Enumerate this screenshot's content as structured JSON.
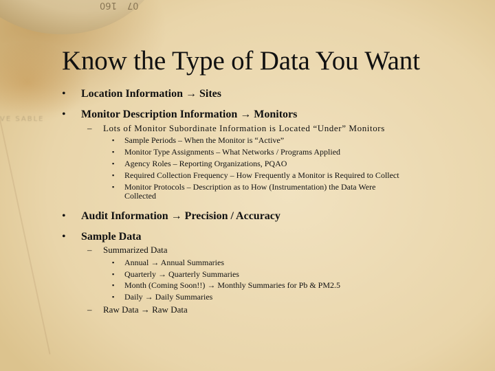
{
  "slide": {
    "title": "Know the Type of Data You Want",
    "background": {
      "compass_numbers": [
        "160",
        "07"
      ],
      "map_label": "VE SABLE"
    },
    "bullet_glyph": "•",
    "dash_glyph": "–",
    "items": [
      {
        "label": "Location Information → Sites"
      },
      {
        "label": "Monitor Description Information → Monitors",
        "sub": {
          "label": "Lots of Monitor Subordinate Information is Located “Under” Monitors",
          "items": [
            "Sample Periods – When the Monitor is “Active”",
            "Monitor Type Assignments – What Networks / Programs Applied",
            "Agency Roles – Reporting Organizations, PQAO",
            "Required Collection Frequency – How Frequently a Monitor is Required to Collect",
            "Monitor Protocols – Description as to How (Instrumentation) the Data Were",
            "Collected"
          ]
        }
      },
      {
        "label": "Audit Information → Precision / Accuracy"
      },
      {
        "label": "Sample Data",
        "subs": [
          {
            "label": "Summarized Data",
            "items": [
              "Annual → Annual Summaries",
              "Quarterly → Quarterly Summaries",
              "Month (Coming Soon!!) → Monthly Summaries for Pb & PM2.5",
              "Daily → Daily Summaries"
            ]
          },
          {
            "label": "Raw Data → Raw Data"
          }
        ]
      }
    ]
  }
}
